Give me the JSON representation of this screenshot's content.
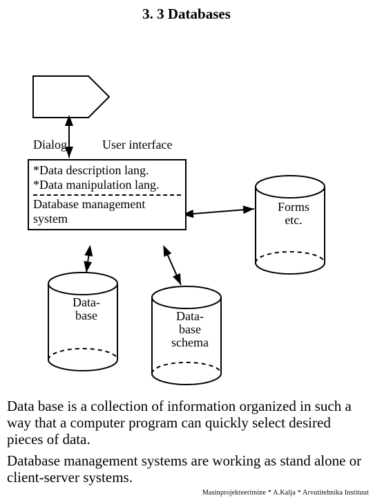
{
  "title": "3. 3 Databases",
  "labels": {
    "dialog": "Dialog",
    "user_interface": "User interface",
    "ddl": "*Data description lang.",
    "dml": "*Data manipulation lang.",
    "dbms": "Database management system",
    "forms": "Forms",
    "etc": "etc.",
    "database_l1": "Data-",
    "database_l2": "base",
    "schema_l1": "Data-",
    "schema_l2": "base",
    "schema_l3": "schema"
  },
  "paragraph1": "Data base is a collection of information organized in such a way that a computer program can quickly select desired pieces of data.",
  "paragraph2": "Database management systems are working as stand alone or  client-server systems.",
  "footer": "Masinprojekteerimine * A.Kalja * Arvutitehnika Instituut"
}
